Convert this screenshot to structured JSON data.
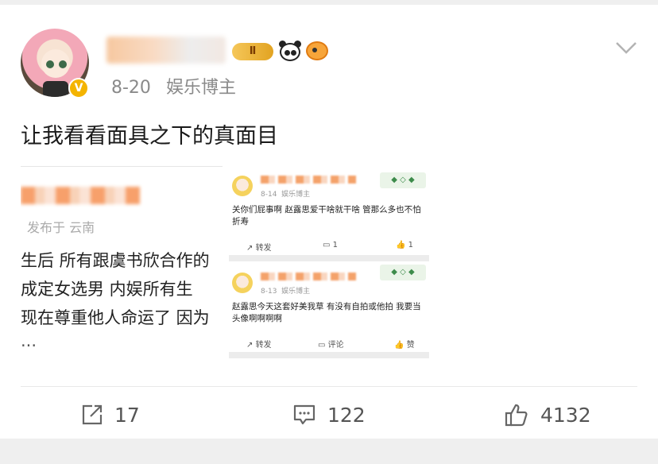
{
  "post": {
    "level_badge": "Ⅱ",
    "date": "8-20",
    "source": "娱乐博主",
    "text": "让我看看面具之下的真面目",
    "more_icon": "chevron-down-icon"
  },
  "repost_preview": {
    "meta": "发布于 云南",
    "lines": [
      "生后 所有跟虞书欣合作的",
      "成定女选男 内娱所有生",
      "现在尊重他人命运了 因为",
      "..."
    ]
  },
  "screenshot": {
    "items": [
      {
        "date": "8-14",
        "source": "娱乐博主",
        "text": "关你们屁事啊 赵露思爱干啥就干啥 管那么多也不怕折寿",
        "repost": "转发",
        "comment_count": "1",
        "like_count": "1"
      },
      {
        "date": "8-13",
        "source": "娱乐博主",
        "text": "赵露思今天这套好美我草 有没有自拍或他拍 我要当头像啊啊啊啊",
        "repost": "转发",
        "comment": "评论",
        "like": "赞"
      }
    ]
  },
  "actions": {
    "repost_count": "17",
    "comment_count": "122",
    "like_count": "4132"
  },
  "colors": {
    "accent": "#f4b400",
    "text": "#1a1a1a",
    "muted": "#8a8a8a"
  }
}
